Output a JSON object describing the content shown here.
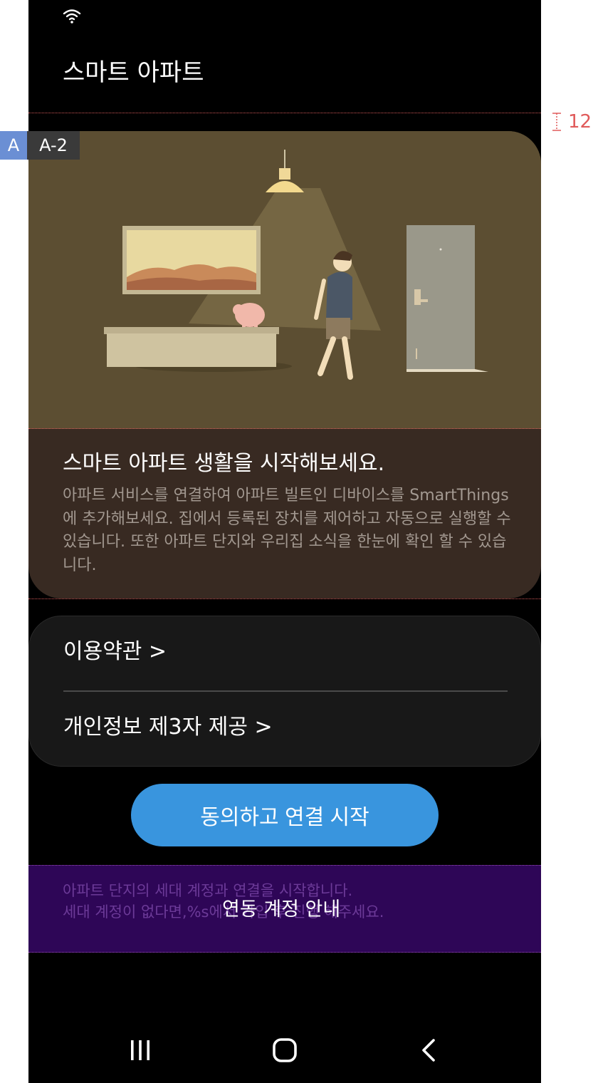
{
  "status_bar": {
    "wifi_icon": "wifi-icon"
  },
  "header": {
    "title": "스마트 아파트"
  },
  "hero": {
    "title": "스마트 아파트 생활을 시작해보세요.",
    "description": "아파트 서비스를 연결하여 아파트 빌트인 디바이스를 SmartThings에 추가해보세요. 집에서 등록된 장치를 제어하고 자동으로 실행할 수 있습니다. 또한 아파트 단지와 우리집 소식을 한눈에 확인 할 수 있습니다."
  },
  "terms": {
    "items": [
      {
        "label": "이용약관 >"
      },
      {
        "label": "개인정보 제3자 제공 >"
      }
    ]
  },
  "primary_button": {
    "label": "동의하고 연결 시작"
  },
  "info": {
    "line1": "아파트 단지의 세대 계정과 연결을 시작합니다.",
    "line2": "세대 계정이 없다면,%s에서 가입 후 진행 해주세요.",
    "link_label": "연동 계정 안내"
  },
  "navigation": {
    "recents_icon": "recents-icon",
    "home_icon": "home-icon",
    "back_icon": "back-icon"
  },
  "annotations": {
    "region_a": "A",
    "region_a2": "A-2",
    "spacing_value": "12"
  },
  "colors": {
    "background": "#000000",
    "illustration_bg": "#5c4e32",
    "hero_text_bg": "#382a22",
    "terms_card_bg": "#181818",
    "primary_button": "#3995de",
    "info_panel": "#2e0657"
  }
}
